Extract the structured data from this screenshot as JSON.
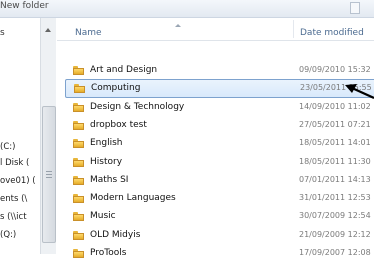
{
  "window": {
    "title": "New folder"
  },
  "navigation": {
    "items": [
      "(C:)",
      "l Disk (",
      "ove01) (",
      "ents (\\",
      "s (\\\\ict",
      "(Q:)"
    ]
  },
  "columns": {
    "name": "Name",
    "date": "Date modified"
  },
  "files": [
    {
      "name": "Art and Design",
      "date": "09/09/2010 15:32"
    },
    {
      "name": "Computing",
      "date": "23/05/2011 15:55",
      "selected": true
    },
    {
      "name": "Design & Technology",
      "date": "14/09/2010 11:02"
    },
    {
      "name": "dropbox test",
      "date": "27/05/2011 07:21"
    },
    {
      "name": "English",
      "date": "18/05/2011 14:01"
    },
    {
      "name": "History",
      "date": "18/05/2011 11:30"
    },
    {
      "name": "Maths SI",
      "date": "07/01/2011 14:13"
    },
    {
      "name": "Modern Languages",
      "date": "31/01/2011 12:53"
    },
    {
      "name": "Music",
      "date": "30/07/2009 12:54"
    },
    {
      "name": "OLD Midyis",
      "date": "21/09/2009 12:12"
    },
    {
      "name": "ProTools",
      "date": "17/09/2007 12:08"
    }
  ],
  "annotation": {
    "icon": "arrow-left-icon",
    "color": "#000000"
  }
}
